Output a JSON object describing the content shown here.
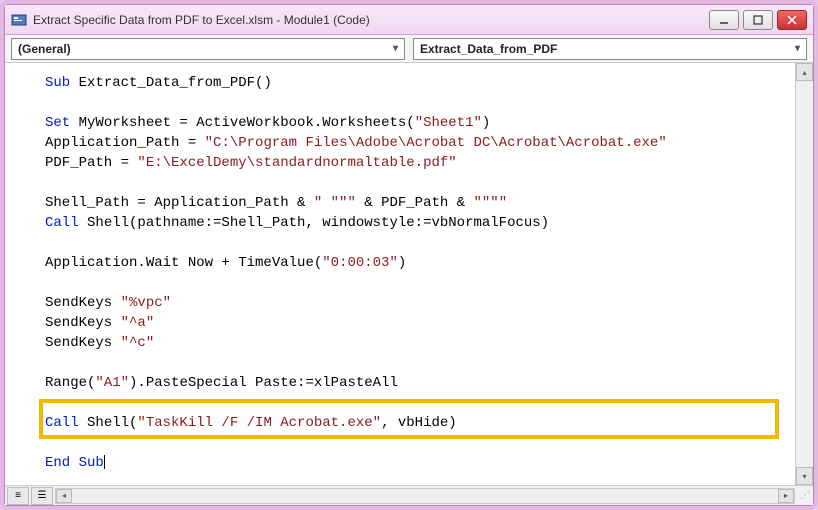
{
  "titlebar": {
    "title": "Extract Specific Data from PDF to Excel.xlsm - Module1 (Code)"
  },
  "dropdowns": {
    "object": "(General)",
    "procedure": "Extract_Data_from_PDF"
  },
  "code": {
    "l1a": "Sub",
    "l1b": " Extract_Data_from_PDF()",
    "l2": "",
    "l3a": "Set",
    "l3b": " MyWorksheet = ActiveWorkbook.Worksheets(",
    "l3c": "\"Sheet1\"",
    "l3d": ")",
    "l4a": "Application_Path = ",
    "l4b": "\"C:\\Program Files\\Adobe\\Acrobat DC\\Acrobat\\Acrobat.exe\"",
    "l5a": "PDF_Path = ",
    "l5b": "\"E:\\ExcelDemy\\standardnormaltable.pdf\"",
    "l6": "",
    "l7a": "Shell_Path = Application_Path & ",
    "l7b": "\" \"\"\"",
    "l7c": " & PDF_Path & ",
    "l7d": "\"\"\"\"",
    "l8a": "Call",
    "l8b": " Shell(pathname:=Shell_Path, windowstyle:=vbNormalFocus)",
    "l9": "",
    "l10a": "Application.Wait Now + TimeValue(",
    "l10b": "\"0:00:03\"",
    "l10c": ")",
    "l11": "",
    "l12a": "SendKeys ",
    "l12b": "\"%vpc\"",
    "l13a": "SendKeys ",
    "l13b": "\"^a\"",
    "l14a": "SendKeys ",
    "l14b": "\"^c\"",
    "l15": "",
    "l16a": "Range(",
    "l16b": "\"A1\"",
    "l16c": ").PasteSpecial Paste:=xlPasteAll",
    "l17": "",
    "l18a": "Call",
    "l18b": " Shell(",
    "l18c": "\"TaskKill /F /IM Acrobat.exe\"",
    "l18d": ", vbHide)",
    "l19": "",
    "l20": "End Sub"
  }
}
